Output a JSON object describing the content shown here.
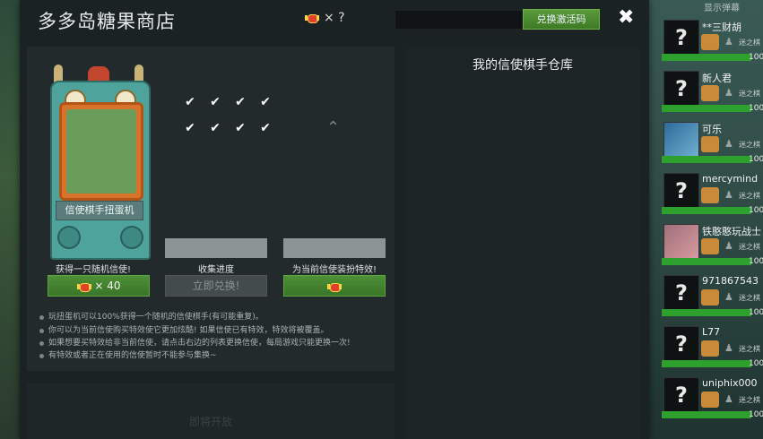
{
  "shop": {
    "title": "多多岛糖果商店",
    "candy_count": "× ?",
    "redeem_button": "兑换激活码",
    "close": "✖"
  },
  "left": {
    "machine_label": "信使棋手扭蛋机",
    "col1_label": "获得一只随机信使!",
    "col2_label": "收集进度",
    "col3_label": "为当前信使装扮特效!",
    "btn1_price": "× 40",
    "btn2_label": "立即兑换!",
    "checks": [
      "✔",
      "✔",
      "✔",
      "✔",
      "✔",
      "✔",
      "✔",
      "✔"
    ],
    "notes": [
      "玩扭蛋机可以100%获得一个随机的信使棋手(有可能重复)。",
      "你可以为当前信使购买特效使它更加炫酷! 如果信使已有特效，特效将被覆盖。",
      "如果想要买特效给非当前信使，请点击右边的列表更换信使，每局游戏只能更换一次!",
      "有特效或者正在使用的信使暂时不能参与集换~"
    ],
    "coming_soon": "即将开放"
  },
  "right": {
    "title": "我的信使棋手仓库"
  },
  "sidebar": {
    "toggle_label": "显示弹幕",
    "players": [
      {
        "name": "**三财胡",
        "avatar": "?",
        "sub": "迷之棋",
        "hp": "100"
      },
      {
        "name": "新人君",
        "avatar": "?",
        "sub": "迷之棋",
        "hp": "100"
      },
      {
        "name": "可乐",
        "avatar": "",
        "sub": "迷之棋",
        "hp": "100"
      },
      {
        "name": "mercymind",
        "avatar": "?",
        "sub": "迷之棋",
        "hp": "100"
      },
      {
        "name": "铁憨憨玩战士",
        "avatar": "",
        "sub": "迷之棋",
        "hp": "100"
      },
      {
        "name": "971867543",
        "avatar": "?",
        "sub": "迷之棋",
        "hp": "100"
      },
      {
        "name": "L77",
        "avatar": "?",
        "sub": "迷之棋",
        "hp": "100"
      },
      {
        "name": "uniphix000",
        "avatar": "?",
        "sub": "迷之棋",
        "hp": "100"
      }
    ]
  },
  "colors": {
    "accent_green": "#3e7a25",
    "health_green": "#2da02d",
    "panel": "#232a2b"
  }
}
